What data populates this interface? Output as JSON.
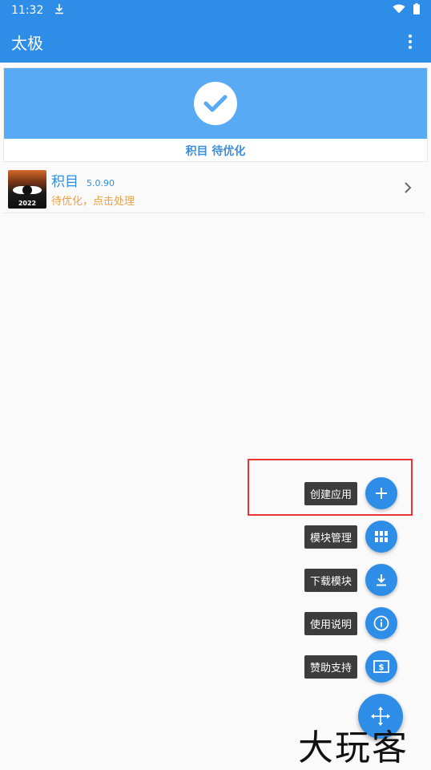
{
  "status_bar": {
    "time": "11:32"
  },
  "app_bar": {
    "title": "太极"
  },
  "status_card": {
    "label": "积目 待优化"
  },
  "app_item": {
    "name": "积目",
    "version": "5.0.90",
    "subtitle": "待优化，点击处理",
    "icon_text": "2022"
  },
  "fab_menu": {
    "items": [
      {
        "label": "创建应用",
        "icon": "plus-icon"
      },
      {
        "label": "模块管理",
        "icon": "grid-icon"
      },
      {
        "label": "下载模块",
        "icon": "download-icon"
      },
      {
        "label": "使用说明",
        "icon": "info-icon"
      },
      {
        "label": "赞助支持",
        "icon": "donate-icon"
      }
    ],
    "main_icon": "move-arrows-icon"
  },
  "watermark": "大玩客",
  "colors": {
    "primary": "#2e8ee7",
    "banner": "#59aaf5",
    "warning": "#f0a040",
    "highlight": "#e33333"
  }
}
